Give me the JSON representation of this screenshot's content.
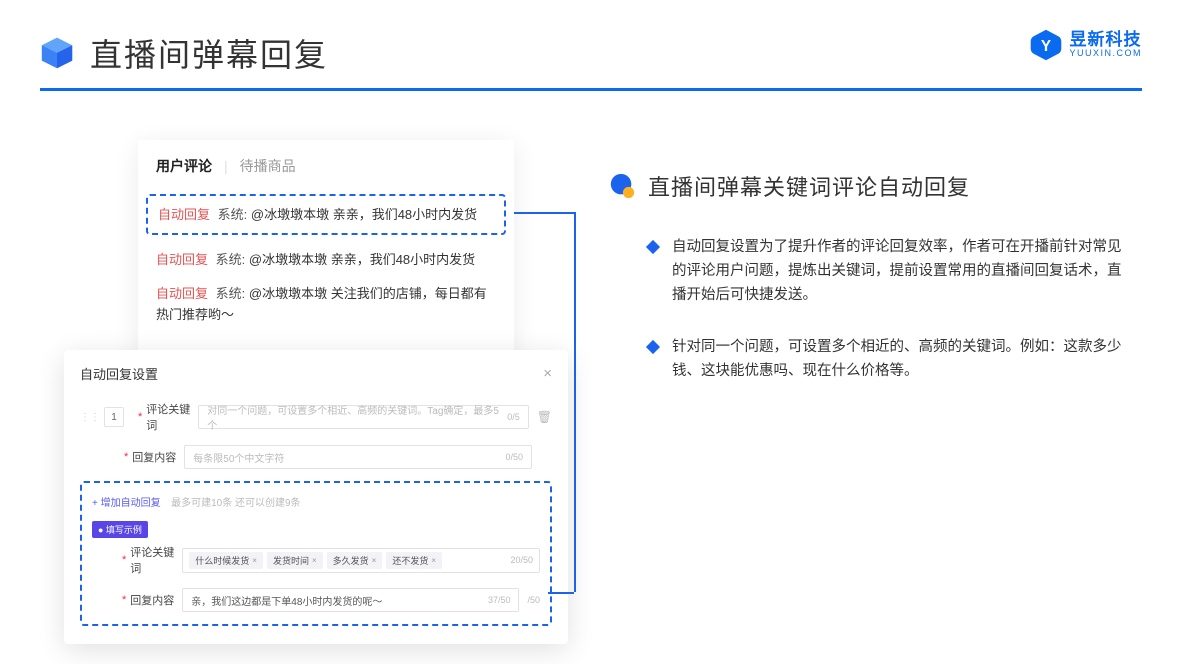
{
  "header": {
    "title": "直播间弹幕回复"
  },
  "brand": {
    "cn": "昱新科技",
    "en": "YUUXIN.COM"
  },
  "comments": {
    "tab_active": "用户评论",
    "tab_inactive": "待播商品",
    "tag": "自动回复",
    "sys_prefix": "系统:",
    "line1": "@冰墩墩本墩 亲亲，我们48小时内发货",
    "line2": "@冰墩墩本墩 亲亲，我们48小时内发货",
    "line3": "@冰墩墩本墩 关注我们的店铺，每日都有热门推荐哟～"
  },
  "settings": {
    "title": "自动回复设置",
    "row_num": "1",
    "label_keyword": "评论关键词",
    "ph_keyword": "对同一个问题，可设置多个相近、高频的关键词。Tag确定，最多5个",
    "count_keyword": "0/5",
    "label_content": "回复内容",
    "ph_content": "每条限50个中文字符",
    "count_content": "0/50",
    "add_link": "+ 增加自动回复",
    "add_hint": "最多可建10条 还可以创建9条",
    "badge": "● 填写示例",
    "ex_label_keyword": "评论关键词",
    "ex_pill1": "什么时候发货",
    "ex_pill2": "发货时间",
    "ex_pill3": "多久发货",
    "ex_pill4": "还不发货",
    "ex_count_keyword": "20/50",
    "ex_label_content": "回复内容",
    "ex_content_val": "亲，我们这边都是下单48小时内发货的呢～",
    "ex_count_content": "37/50",
    "ex_right_count": "/50"
  },
  "right": {
    "title": "直播间弹幕关键词评论自动回复",
    "bullet1": "自动回复设置为了提升作者的评论回复效率，作者可在开播前针对常见的评论用户问题，提炼出关键词，提前设置常用的直播间回复话术，直播开始后可快捷发送。",
    "bullet2": "针对同一个问题，可设置多个相近的、高频的关键词。例如：这款多少钱、这块能优惠吗、现在什么价格等。"
  }
}
